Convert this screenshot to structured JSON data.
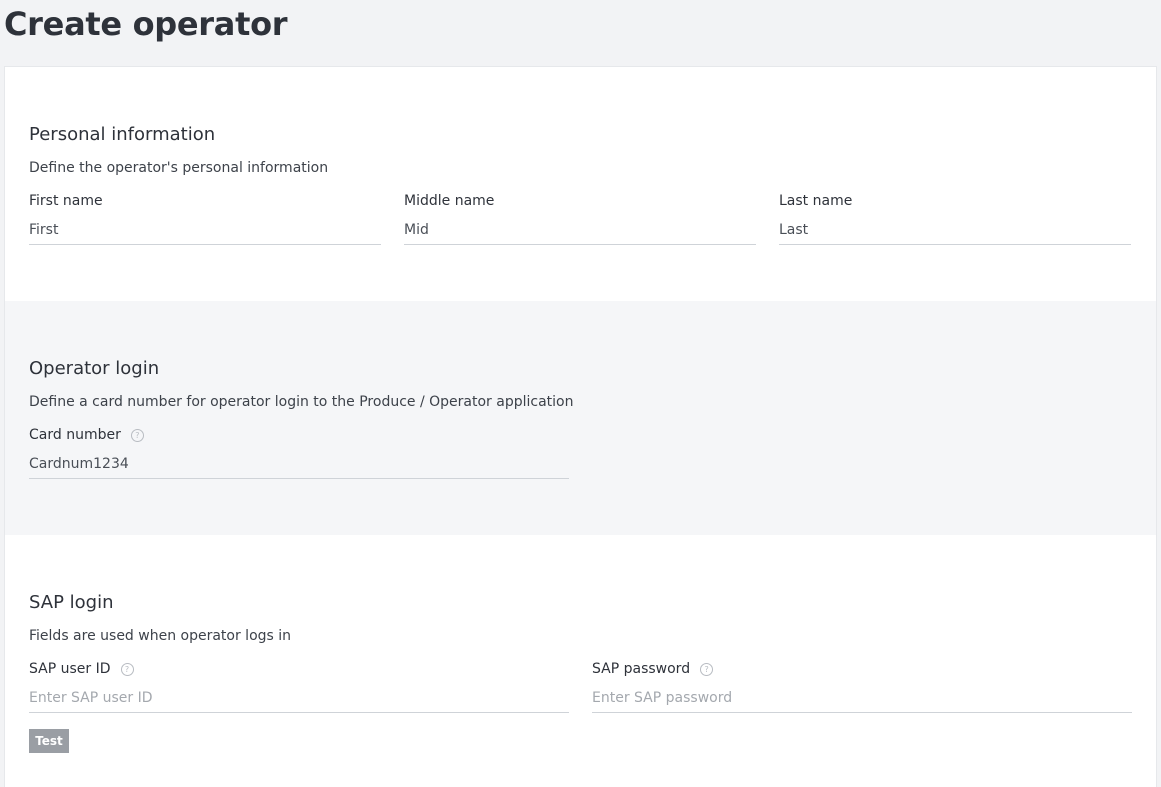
{
  "page": {
    "title": "Create operator"
  },
  "personal_information": {
    "title": "Personal information",
    "description": "Define the operator's personal information",
    "first_name": {
      "label": "First name",
      "value": "First"
    },
    "middle_name": {
      "label": "Middle name",
      "value": "Mid"
    },
    "last_name": {
      "label": "Last name",
      "value": "Last"
    }
  },
  "operator_login": {
    "title": "Operator login",
    "description": "Define a card number for operator login to the Produce / Operator application",
    "card_number": {
      "label": "Card number",
      "value": "Cardnum1234",
      "help_icon": "question-circle-icon"
    }
  },
  "sap_login": {
    "title": "SAP login",
    "description": "Fields are used when operator logs in",
    "user_id": {
      "label": "SAP user ID",
      "value": "",
      "placeholder": "Enter SAP user ID",
      "help_icon": "question-circle-icon"
    },
    "password": {
      "label": "SAP password",
      "value": "",
      "placeholder": "Enter SAP password",
      "help_icon": "question-circle-icon"
    },
    "test_label": "Test"
  },
  "colors": {
    "page_background": "#f2f3f5",
    "card_background": "#ffffff",
    "section_alt_background": "#f5f6f8",
    "test_button": "#9a9ea4"
  }
}
